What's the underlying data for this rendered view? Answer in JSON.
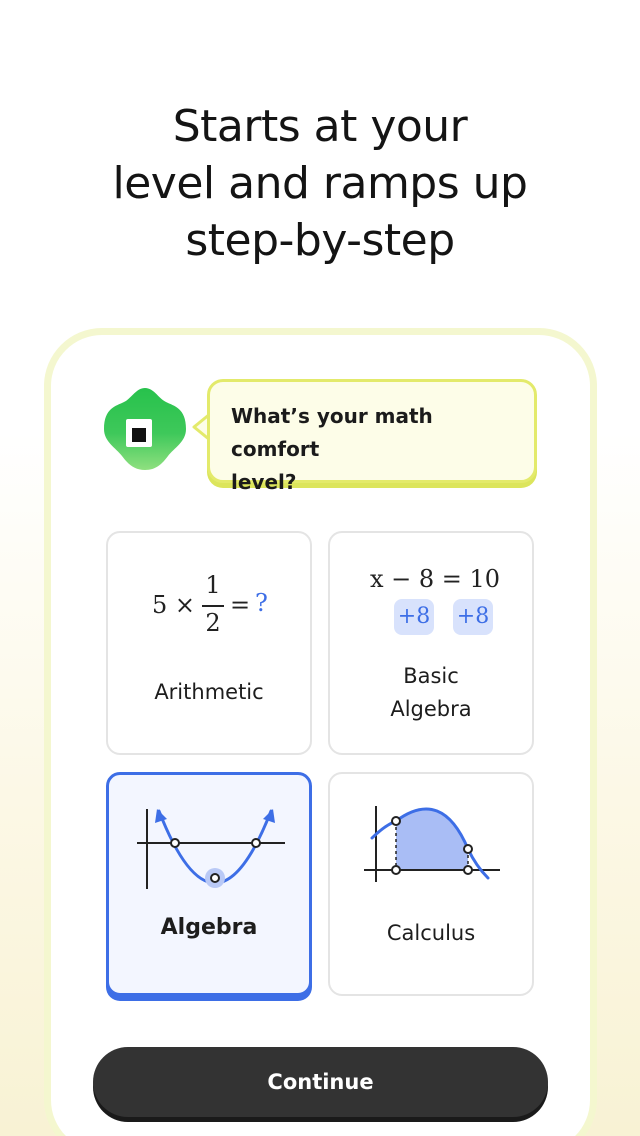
{
  "headline": {
    "line1": "Starts at your",
    "line2": "level and ramps up",
    "line3": "step-by-step"
  },
  "question": {
    "line1": "What’s your math comfort",
    "line2": "level?"
  },
  "options": [
    {
      "label": "Arithmetic",
      "selected": false,
      "example": {
        "lhs": "5 ×",
        "num": "1",
        "den": "2",
        "eq": "=",
        "unknown": "?"
      }
    },
    {
      "label_line1": "Basic",
      "label_line2": "Algebra",
      "selected": false,
      "example": {
        "equation": "x − 8 = 10",
        "chip_left": "+8",
        "chip_right": "+8"
      }
    },
    {
      "label": "Algebra",
      "selected": true,
      "icon": "parabola-graph"
    },
    {
      "label": "Calculus",
      "selected": false,
      "icon": "area-under-curve-graph"
    }
  ],
  "continue_label": "Continue",
  "colors": {
    "accent_blue": "#3d6ee6",
    "mascot_green": "#3ec85a",
    "bubble_border": "#e3ea6b",
    "button_dark": "#333333"
  }
}
